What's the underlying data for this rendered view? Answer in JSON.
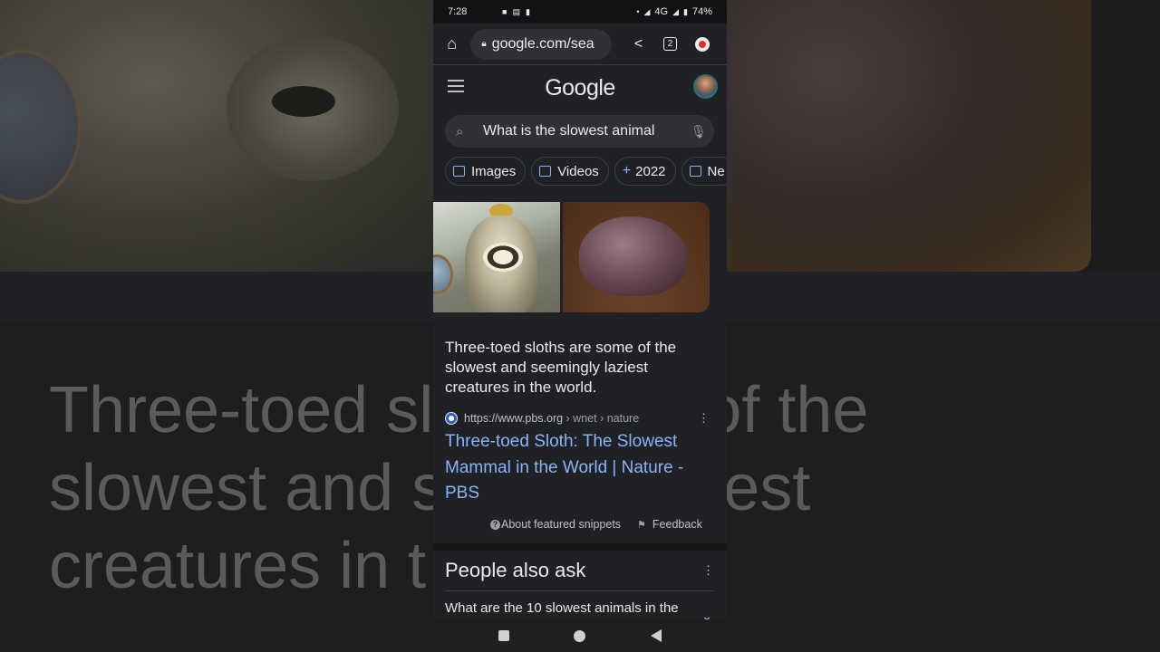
{
  "status_bar": {
    "time": "7:28",
    "network": "4G",
    "battery": "74%"
  },
  "browser": {
    "url": "google.com/sea",
    "tab_count": "2"
  },
  "google": {
    "logo": "Google",
    "search_query": "What is the slowest animal",
    "chips": [
      {
        "label": "Images",
        "icon": "image-icon"
      },
      {
        "label": "Videos",
        "icon": "video-icon"
      },
      {
        "label": "2022",
        "icon": "plus-icon"
      },
      {
        "label": "Ne",
        "icon": "news-icon"
      }
    ]
  },
  "featured_snippet": {
    "text": "Three-toed sloths are some of the slowest and seemingly laziest creatures in the world.",
    "source_domain": "https://www.pbs.org",
    "source_path": " › wnet › nature",
    "title": "Three-toed Sloth: The Slowest Mammal in the World | Nature - PBS",
    "about_label": "About featured snippets",
    "feedback_label": "Feedback"
  },
  "people_also_ask": {
    "title": "People also ask",
    "questions": [
      "What are the 10 slowest animals in the"
    ]
  },
  "background": {
    "text": "Three-toed sl       ome of the\nslowest and s          laziest\ncreatures in t"
  }
}
